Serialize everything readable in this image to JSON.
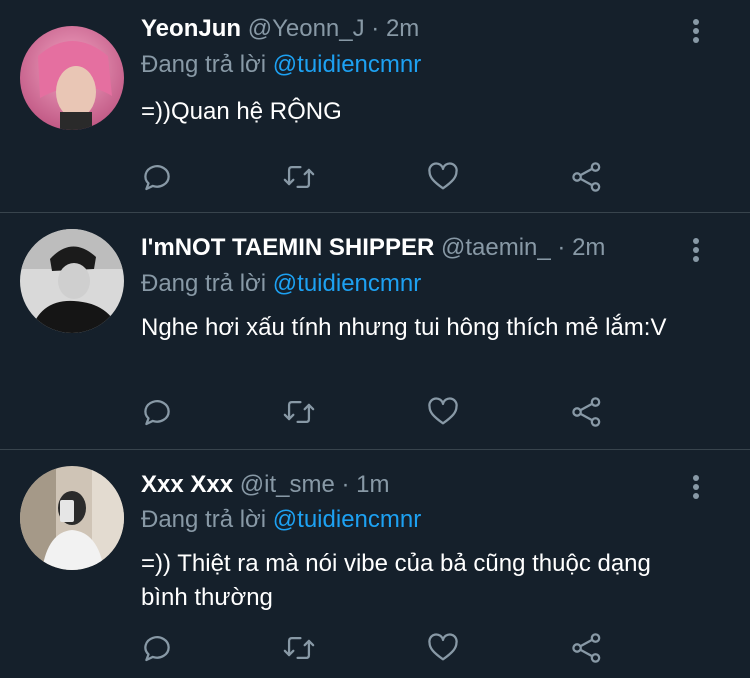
{
  "tweets": [
    {
      "name": "YeonJun",
      "handle": "@Yeonn_J",
      "dot": "·",
      "time": "2m",
      "reply_prefix": "Đang trả lời",
      "reply_to": "@tuidiencmnr",
      "text": "=))Quan hệ RỘNG"
    },
    {
      "name": "I'mNOT TAEMIN SHIPPER",
      "handle": "@taemin_",
      "dot": "·",
      "time": "2m",
      "reply_prefix": "Đang trả lời",
      "reply_to": "@tuidiencmnr",
      "text": "Nghe hơi xấu tính nhưng tui hông thích mẻ lắm:V"
    },
    {
      "name": "Xxx Xxx",
      "handle": "@it_sme",
      "dot": "·",
      "time": "1m",
      "reply_prefix": "Đang trả lời",
      "reply_to": "@tuidiencmnr",
      "text": "=)) Thiệt ra mà nói vibe của bả cũng thuộc dạng bình thường"
    }
  ],
  "icons": {
    "reply": "reply-icon",
    "retweet": "retweet-icon",
    "like": "heart-icon",
    "share": "share-icon",
    "more": "more-options-icon"
  },
  "colors": {
    "background": "#15202b",
    "divider": "#38444d",
    "secondary_text": "#8899a6",
    "link": "#1da1f2"
  }
}
